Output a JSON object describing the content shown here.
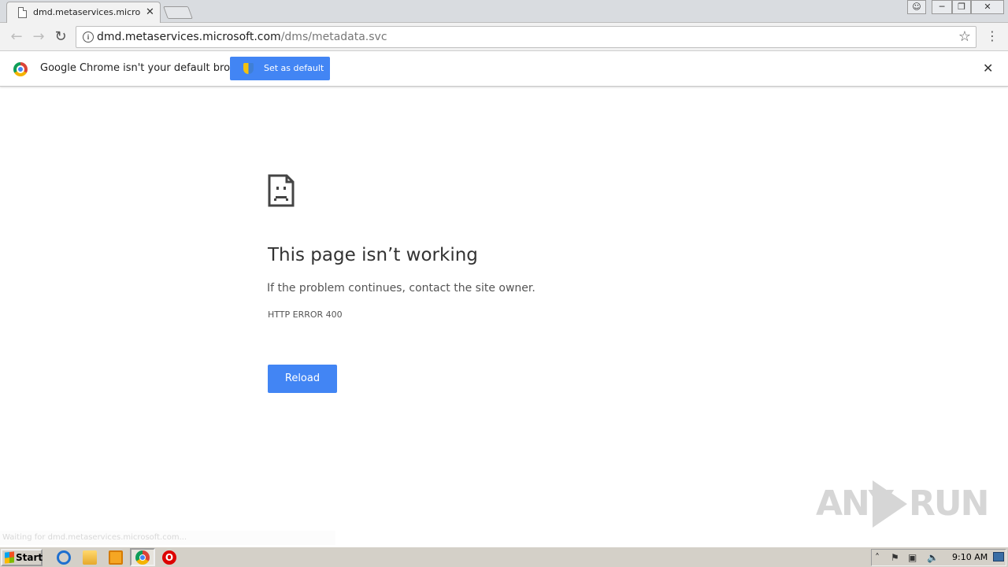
{
  "browser": {
    "tab_title": "dmd.metaservices.microsoft",
    "url_host": "dmd.metaservices.microsoft.com",
    "url_path": "/dms/metadata.svc"
  },
  "infobar": {
    "message": "Google Chrome isn't your default browser",
    "button_label": "Set as default"
  },
  "error": {
    "title": "This page isn’t working",
    "description": "If the problem continues, contact the site owner.",
    "code": "HTTP ERROR 400",
    "reload_label": "Reload"
  },
  "status_bar": {
    "text": "Waiting for dmd.metaservices.microsoft.com..."
  },
  "watermark": {
    "left": "ANY",
    "right": "RUN"
  },
  "taskbar": {
    "start_label": "Start",
    "clock": "9:10 AM"
  },
  "colors": {
    "accent": "#4285f4",
    "taskbar": "#d4d0c8"
  }
}
